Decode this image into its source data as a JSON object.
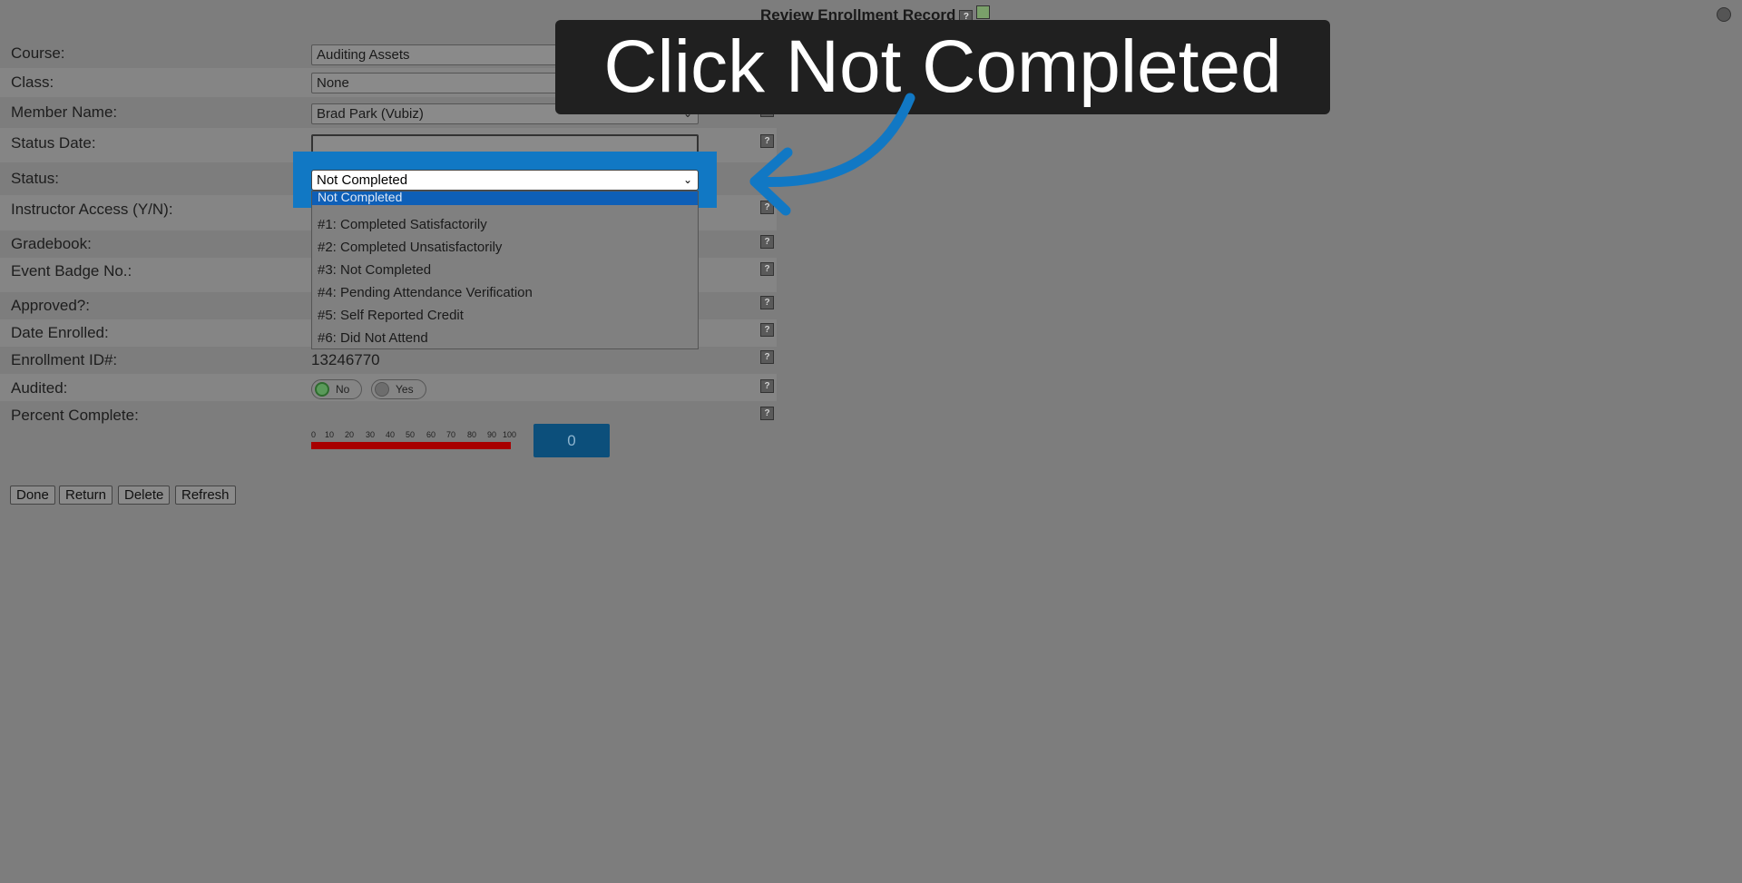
{
  "header": {
    "title": "Review Enrollment Record",
    "help_icon": "?",
    "refresh_icon": "refresh-icon"
  },
  "form": {
    "course": {
      "label": "Course:",
      "value": "Auditing Assets"
    },
    "class": {
      "label": "Class:",
      "value": "None"
    },
    "member_name": {
      "label": "Member Name:",
      "value": "Brad Park (Vubiz)"
    },
    "status_date": {
      "label": "Status Date:",
      "value": ""
    },
    "status": {
      "label": "Status:",
      "value": "Not Completed",
      "highlighted_option": "Not Completed",
      "options": [
        "#1: Completed Satisfactorily",
        "#2: Completed Unsatisfactorily",
        "#3: Not Completed",
        "#4: Pending Attendance Verification",
        "#5: Self Reported Credit",
        "#6: Did Not Attend"
      ]
    },
    "instructor_access": {
      "label": "Instructor Access (Y/N):"
    },
    "gradebook": {
      "label": "Gradebook:"
    },
    "event_badge": {
      "label": "Event Badge No.:"
    },
    "approved": {
      "label": "Approved?:"
    },
    "date_enrolled": {
      "label": "Date Enrolled:"
    },
    "enrollment_id": {
      "label": "Enrollment ID#:",
      "value": "13246770"
    },
    "audited": {
      "label": "Audited:",
      "no_label": "No",
      "yes_label": "Yes",
      "selected": "No"
    },
    "percent_complete": {
      "label": "Percent Complete:",
      "value": "0",
      "fraction": 0,
      "scale": [
        "0",
        "10",
        "20",
        "30",
        "40",
        "50",
        "60",
        "70",
        "80",
        "90",
        "100"
      ]
    }
  },
  "buttons": {
    "done": "Done",
    "return": "Return",
    "delete": "Delete",
    "refresh": "Refresh"
  },
  "overlay": {
    "instruction": "Click Not Completed",
    "accent_color": "#1178c4"
  },
  "colors": {
    "progress_bar": "#a80000",
    "percent_box": "#0c4f7b",
    "dropdown_selected": "#0e5fb7"
  }
}
